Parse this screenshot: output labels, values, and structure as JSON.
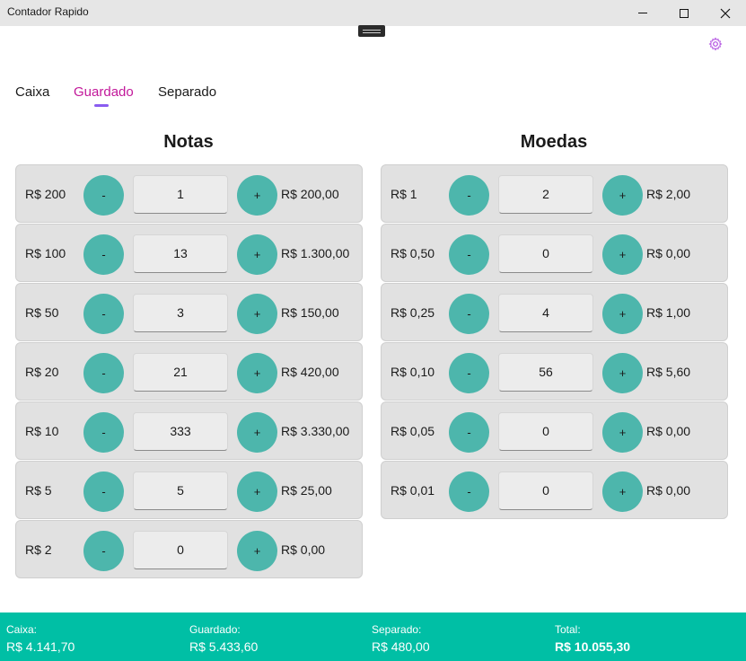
{
  "window": {
    "title": "Contador Rapido",
    "minimize": "—",
    "maximize": "☐",
    "close": "✕"
  },
  "tabs": [
    {
      "label": "Caixa",
      "active": false
    },
    {
      "label": "Guardado",
      "active": true
    },
    {
      "label": "Separado",
      "active": false
    }
  ],
  "colors": {
    "accent_tab": "#c2189a",
    "tab_indicator": "#8a5cf0",
    "button": "#4db6ac",
    "footer": "#00bfa5",
    "gear": "#b04de0"
  },
  "notas": {
    "title": "Notas",
    "rows": [
      {
        "label": "R$ 200",
        "count": "1",
        "total": "R$ 200,00"
      },
      {
        "label": "R$ 100",
        "count": "13",
        "total": "R$ 1.300,00"
      },
      {
        "label": "R$ 50",
        "count": "3",
        "total": "R$ 150,00"
      },
      {
        "label": "R$ 20",
        "count": "21",
        "total": "R$ 420,00"
      },
      {
        "label": "R$ 10",
        "count": "333",
        "total": "R$ 3.330,00"
      },
      {
        "label": "R$ 5",
        "count": "5",
        "total": "R$ 25,00"
      },
      {
        "label": "R$ 2",
        "count": "0",
        "total": "R$ 0,00"
      }
    ]
  },
  "moedas": {
    "title": "Moedas",
    "rows": [
      {
        "label": "R$ 1",
        "count": "2",
        "total": "R$ 2,00"
      },
      {
        "label": "R$ 0,50",
        "count": "0",
        "total": "R$ 0,00"
      },
      {
        "label": "R$ 0,25",
        "count": "4",
        "total": "R$ 1,00"
      },
      {
        "label": "R$ 0,10",
        "count": "56",
        "total": "R$ 5,60"
      },
      {
        "label": "R$ 0,05",
        "count": "0",
        "total": "R$ 0,00"
      },
      {
        "label": "R$ 0,01",
        "count": "0",
        "total": "R$ 0,00"
      }
    ]
  },
  "buttons": {
    "minus": "-",
    "plus": "+"
  },
  "footer": {
    "caixa": {
      "label": "Caixa:",
      "value": "R$ 4.141,70"
    },
    "guardado": {
      "label": "Guardado:",
      "value": "R$ 5.433,60"
    },
    "separado": {
      "label": "Separado:",
      "value": "R$ 480,00"
    },
    "total": {
      "label": "Total:",
      "value": "R$ 10.055,30"
    }
  }
}
